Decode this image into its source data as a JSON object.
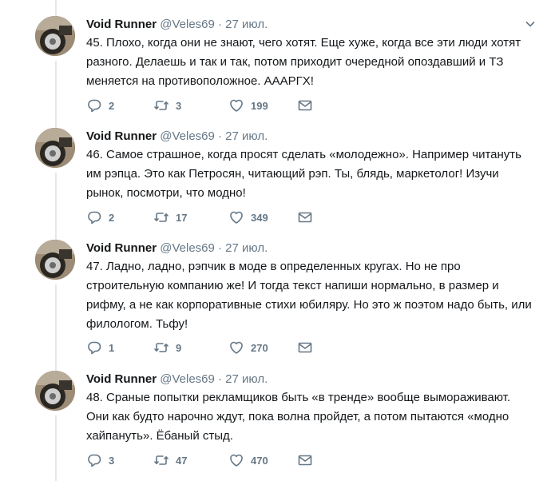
{
  "colors": {
    "text": "#14171a",
    "muted": "#657786",
    "divider": "#e1e8ed"
  },
  "icons": [
    "avatar-image",
    "chevron-down-icon",
    "reply-icon",
    "retweet-icon",
    "heart-icon",
    "envelope-icon"
  ],
  "tweets": [
    {
      "name": "Void Runner",
      "handle": "@Veles69 · 27 июл.",
      "text": "45. Плохо, когда они не знают, чего хотят. Еще хуже, когда все эти люди хотят разного. Делаешь и так и так, потом приходит очередной опоздавший и ТЗ меняется на противоположное. АААРГХ!",
      "replies": "2",
      "retweets": "3",
      "likes": "199"
    },
    {
      "name": "Void Runner",
      "handle": "@Veles69 · 27 июл.",
      "text": "46. Самое страшное, когда просят сделать «молодежно». Например читануть им рэпца. Это как Петросян, читающий рэп. Ты, блядь, маркетолог! Изучи рынок, посмотри, что модно!",
      "replies": "2",
      "retweets": "17",
      "likes": "349"
    },
    {
      "name": "Void Runner",
      "handle": "@Veles69 · 27 июл.",
      "text": "47. Ладно, ладно, рэпчик в моде в определенных кругах. Но не про строительную компанию же! И тогда текст напиши нормально, в размер и рифму, а не как корпоративные стихи юбиляру. Но это ж поэтом надо быть, или филологом. Тьфу!",
      "replies": "1",
      "retweets": "9",
      "likes": "270"
    },
    {
      "name": "Void Runner",
      "handle": "@Veles69 · 27 июл.",
      "text": "48. Сраные попытки рекламщиков быть «в тренде» вообще вымораживают. Они как будто нарочно ждут, пока волна пройдет, а потом пытаются «модно хайпануть». Ёбаный стыд.",
      "replies": "3",
      "retweets": "47",
      "likes": "470"
    }
  ]
}
